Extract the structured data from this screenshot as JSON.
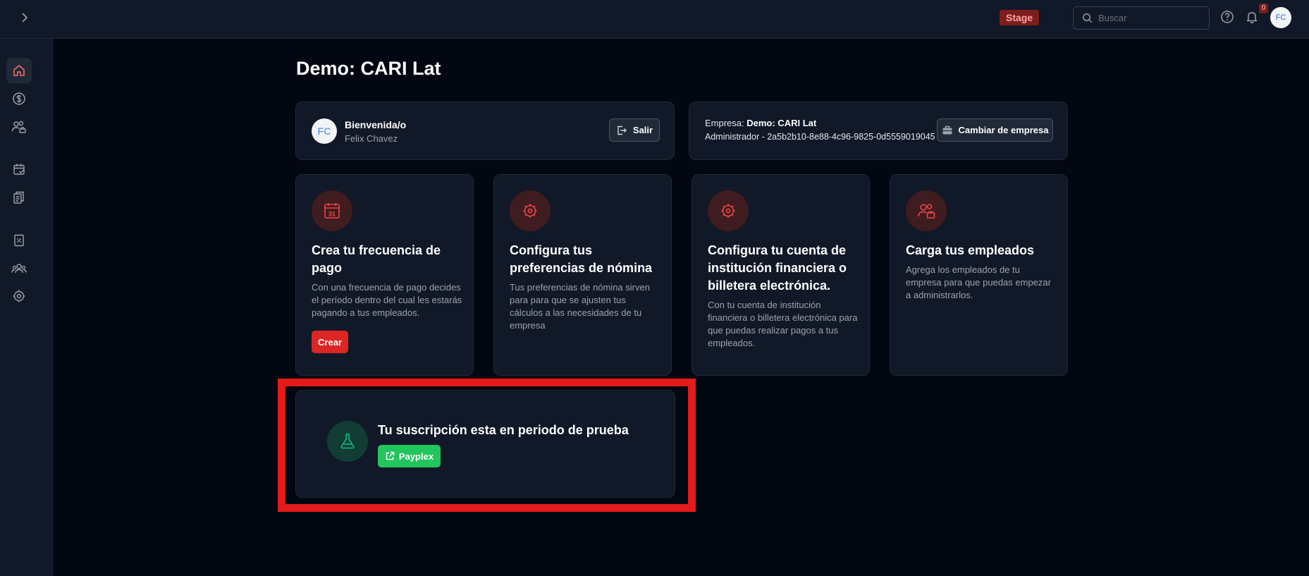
{
  "header": {
    "env_badge": "Stage",
    "search_placeholder": "Buscar",
    "notification_count": "0",
    "avatar_initials": "FC"
  },
  "sidebar": {
    "items": [
      {
        "icon": "home-icon",
        "active": true
      },
      {
        "icon": "dollar-icon"
      },
      {
        "icon": "users-lock-icon"
      },
      {
        "icon": "calendar-check-icon"
      },
      {
        "icon": "documents-icon"
      },
      {
        "icon": "receipt-icon"
      },
      {
        "icon": "team-icon"
      },
      {
        "icon": "settings-icon"
      }
    ]
  },
  "page": {
    "title": "Demo: CARI Lat"
  },
  "welcome": {
    "title": "Bienvenida/o",
    "name": "Felix Chavez",
    "initials": "FC",
    "logout_label": "Salir"
  },
  "company": {
    "company_prefix": "Empresa: ",
    "company_name": "Demo: CARI Lat",
    "admin_text": "Administrador - 2a5b2b10-8e88-4c96-9825-0d5559019045",
    "change_label": "Cambiar de empresa"
  },
  "steps": [
    {
      "icon": "calendar-icon",
      "title": "Crea tu frecuencia de pago",
      "description": "Con una frecuencia de pago decides el período dentro del cual les estarás pagando a tus empleados.",
      "action": "Crear"
    },
    {
      "icon": "gear-icon",
      "title": "Configura tus preferencias de nómina",
      "description": "Tus preferencias de nómina sirven para para que se ajusten tus cálculos a las necesidades de tu empresa"
    },
    {
      "icon": "gear-icon",
      "title": "Configura tu cuenta de institución financiera o billetera electrónica.",
      "description": "Con tu cuenta de institución financiera o billetera electrónica para que puedas realizar pagos a tus empleados."
    },
    {
      "icon": "employees-icon",
      "title": "Carga tus empleados",
      "description": "Agrega los empleados de tu empresa para que puedas empezar a administrarlos."
    }
  ],
  "subscription": {
    "icon": "flask-icon",
    "title": "Tu suscripción esta en periodo de prueba",
    "button_label": "Payplex"
  },
  "colors": {
    "accent_red": "#dc2626",
    "accent_green": "#22c55e",
    "stage_badge": "#7f1d1d",
    "highlight": "#e31b1b"
  }
}
